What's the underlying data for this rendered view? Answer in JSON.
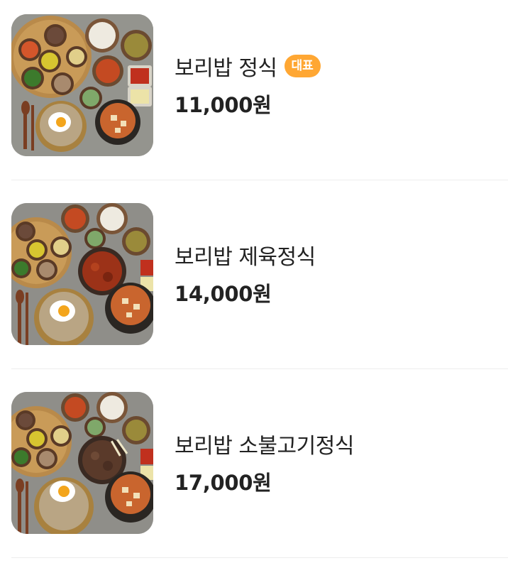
{
  "menu": {
    "items": [
      {
        "name": "보리밥 정식",
        "badge": "대표",
        "price": "11,000원",
        "image": "barley-rice-set-photo"
      },
      {
        "name": "보리밥 제육정식",
        "price": "14,000원",
        "image": "barley-rice-spicy-pork-set-photo"
      },
      {
        "name": "보리밥 소불고기정식",
        "price": "17,000원",
        "image": "barley-rice-beef-bulgogi-set-photo"
      }
    ]
  },
  "colors": {
    "badge_bg": "#ffa733",
    "text": "#222222",
    "divider": "#ededed"
  }
}
